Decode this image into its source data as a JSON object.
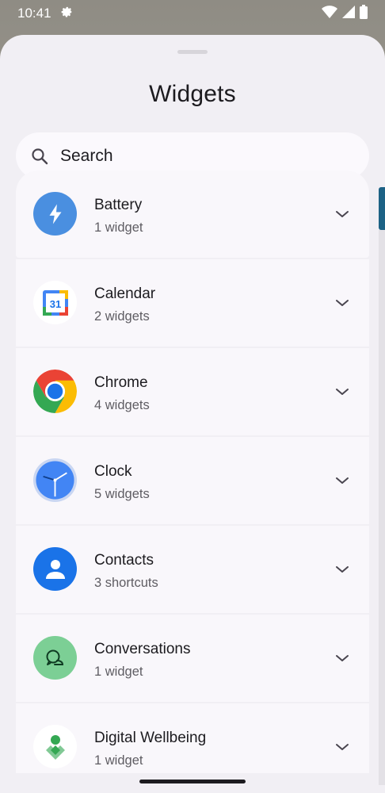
{
  "status_bar": {
    "time": "10:41"
  },
  "sheet": {
    "title": "Widgets",
    "search": {
      "placeholder": "Search"
    }
  },
  "apps": [
    {
      "name": "Battery",
      "count": "1 widget"
    },
    {
      "name": "Calendar",
      "count": "2 widgets",
      "icon_text": "31"
    },
    {
      "name": "Chrome",
      "count": "4 widgets"
    },
    {
      "name": "Clock",
      "count": "5 widgets"
    },
    {
      "name": "Contacts",
      "count": "3 shortcuts"
    },
    {
      "name": "Conversations",
      "count": "1 widget"
    },
    {
      "name": "Digital Wellbeing",
      "count": "1 widget"
    }
  ],
  "colors": {
    "sheet_bg": "#f1eff4",
    "row_bg": "#f9f7fb",
    "battery": "#4a8fe0",
    "contacts": "#1a73e8",
    "conversations": "#7ccf95",
    "scroll_thumb": "#1c6285"
  },
  "icons": {
    "settings": "gear-icon",
    "wifi": "wifi-icon",
    "signal": "signal-icon",
    "battery": "battery-status-icon",
    "search": "search-icon",
    "expand": "chevron-down-icon"
  }
}
